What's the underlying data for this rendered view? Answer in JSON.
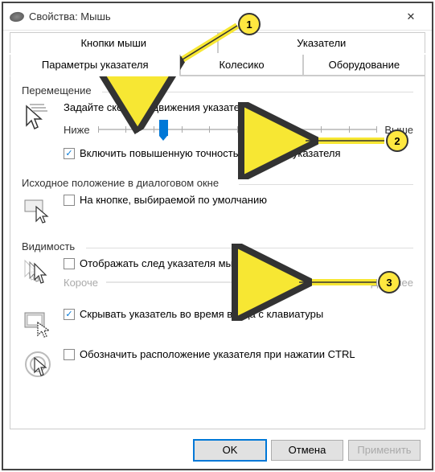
{
  "window": {
    "title": "Свойства: Мышь",
    "close_icon": "✕"
  },
  "tabs": {
    "row1": [
      {
        "label": "Кнопки мыши"
      },
      {
        "label": "Указатели"
      }
    ],
    "row2": [
      {
        "label": "Параметры указателя",
        "active": true
      },
      {
        "label": "Колесико"
      },
      {
        "label": "Оборудование"
      }
    ]
  },
  "groups": {
    "motion": {
      "title": "Перемещение",
      "speed_label": "Задайте скорость движения указателя:",
      "slider_min": "Ниже",
      "slider_max": "Выше",
      "enhance_check": {
        "checked": true,
        "label": "Включить повышенную точность установки указателя"
      }
    },
    "snap": {
      "title": "Исходное положение в диалоговом окне",
      "check": {
        "checked": false,
        "label": "На кнопке, выбираемой по умолчанию"
      }
    },
    "visibility": {
      "title": "Видимость",
      "trail_check": {
        "checked": false,
        "label": "Отображать след указателя мыши"
      },
      "trail_min": "Короче",
      "trail_max": "Длиннее",
      "hide_check": {
        "checked": true,
        "label": "Скрывать указатель во время ввода с клавиатуры"
      },
      "locate_check": {
        "checked": false,
        "label": "Обозначить расположение указателя при нажатии CTRL"
      }
    }
  },
  "buttons": {
    "ok": "OK",
    "cancel": "Отмена",
    "apply": "Применить"
  },
  "annotations": {
    "n1": "1",
    "n2": "2",
    "n3": "3"
  }
}
